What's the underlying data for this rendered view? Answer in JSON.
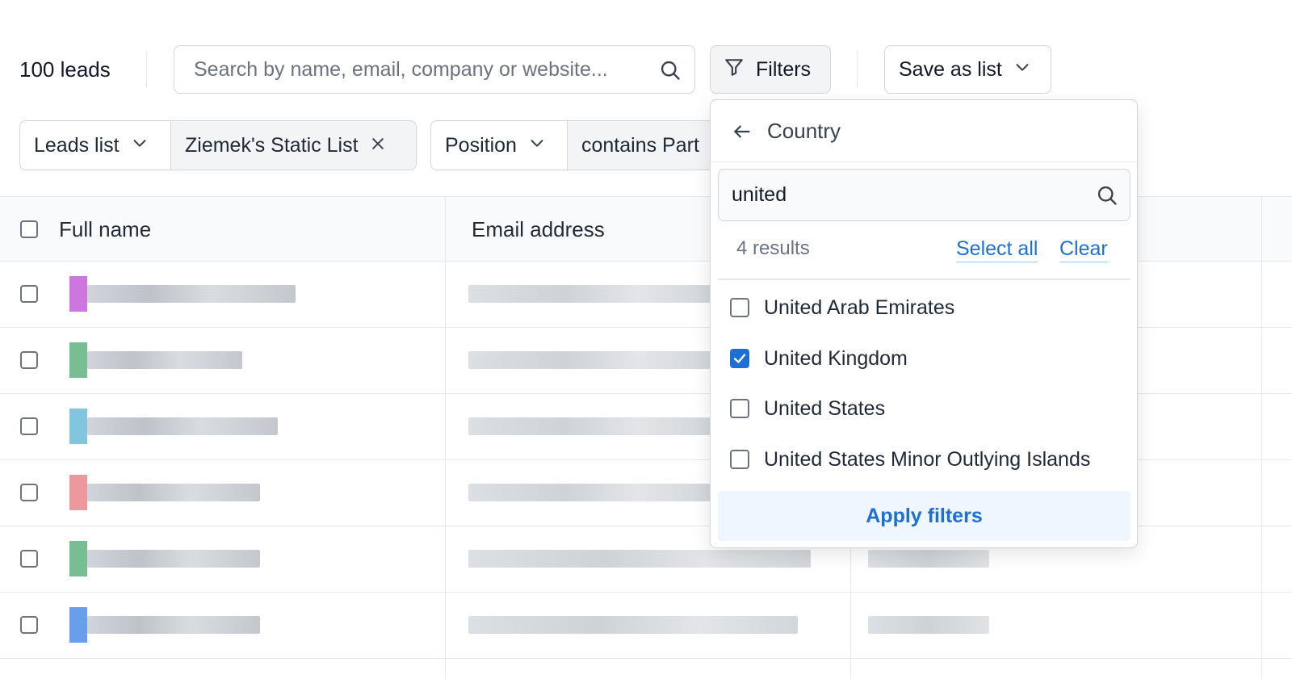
{
  "toolbar": {
    "lead_count": "100 leads",
    "search_placeholder": "Search by name, email, company or website...",
    "filters_label": "Filters",
    "save_label": "Save as list"
  },
  "chips": {
    "leads_list_label": "Leads list",
    "leads_list_value": "Ziemek's Static List",
    "position_label": "Position",
    "position_value": "contains Part"
  },
  "table": {
    "columns": [
      "Full name",
      "Email address"
    ],
    "row_count": 6,
    "avatar_colors": [
      "#c45ed8",
      "#5fb37f",
      "#6bbcd8",
      "#e9868c",
      "#5fb37f",
      "#4d8ee8"
    ]
  },
  "country_filter": {
    "title": "Country",
    "search_value": "united",
    "results_text": "4 results",
    "select_all_label": "Select all",
    "clear_label": "Clear",
    "options": [
      {
        "label": "United Arab Emirates",
        "checked": false
      },
      {
        "label": "United Kingdom",
        "checked": true
      },
      {
        "label": "United States",
        "checked": false
      },
      {
        "label": "United States Minor Outlying Islands",
        "checked": false
      }
    ],
    "apply_label": "Apply filters"
  },
  "colors": {
    "accent": "#1d6fd6",
    "border": "#d1d5db",
    "header_bg": "#f9fafb"
  }
}
